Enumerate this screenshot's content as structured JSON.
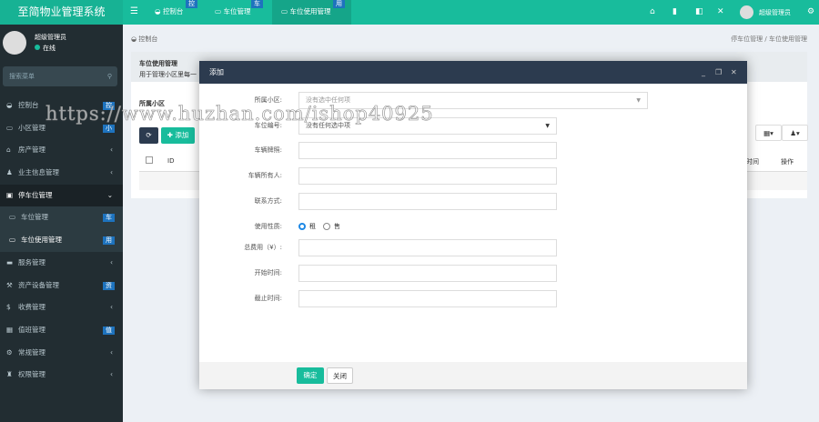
{
  "header": {
    "logo": "至简物业管理系统",
    "tabs": [
      {
        "label": "控制台",
        "badge": "控"
      },
      {
        "label": "车位管理",
        "badge": "车"
      },
      {
        "label": "车位使用管理",
        "badge": "用"
      }
    ],
    "user": "超级管理员"
  },
  "sidebar": {
    "user": "超级管理员",
    "status": "在线",
    "search_placeholder": "搜索菜单",
    "items": [
      {
        "label": "控制台",
        "icon": "dashboard-icon",
        "badge": "控"
      },
      {
        "label": "小区管理",
        "icon": "list-icon",
        "badge": "小"
      },
      {
        "label": "房产管理",
        "icon": "home-icon"
      },
      {
        "label": "业主信息管理",
        "icon": "user-icon"
      },
      {
        "label": "停车位管理",
        "icon": "parking-icon"
      },
      {
        "label": "车位管理",
        "icon": "list-icon",
        "badge": "车"
      },
      {
        "label": "车位使用管理",
        "icon": "list-icon",
        "badge": "用"
      },
      {
        "label": "服务管理",
        "icon": "laptop-icon"
      },
      {
        "label": "资产设备管理",
        "icon": "wrench-icon",
        "badge": "资"
      },
      {
        "label": "收费管理",
        "icon": "dollar-icon"
      },
      {
        "label": "值班管理",
        "icon": "calendar-icon",
        "badge": "值"
      },
      {
        "label": "常规管理",
        "icon": "cogs-icon"
      },
      {
        "label": "权限管理",
        "icon": "group-icon"
      }
    ]
  },
  "breadcrumb": {
    "home": "控制台",
    "path": [
      "停车位管理",
      "车位使用管理"
    ]
  },
  "panel": {
    "title": "车位使用管理",
    "subtitle": "用于管理小区里每一",
    "filter_label": "所属小区",
    "add": "添加",
    "col_id": "ID",
    "col_time": "时间",
    "col_op": "操作"
  },
  "modal": {
    "title": "添加",
    "confirm": "确定",
    "close": "关闭",
    "fields": [
      {
        "label": "所属小区:",
        "value": "没有选中任何项"
      },
      {
        "label": "车位编号:",
        "value": "没有任何选中项"
      },
      {
        "label": "车辆牌照:",
        "value": ""
      },
      {
        "label": "车辆所有人:",
        "value": ""
      },
      {
        "label": "联系方式:",
        "value": ""
      },
      {
        "label": "使用性质:",
        "options": [
          "租",
          "售"
        ],
        "selected": "租"
      },
      {
        "label": "总费用（¥）:",
        "value": ""
      },
      {
        "label": "开始时间:",
        "value": ""
      },
      {
        "label": "截止时间:",
        "value": ""
      }
    ]
  },
  "watermark": "https://www.huzhan.com/ishop40925"
}
